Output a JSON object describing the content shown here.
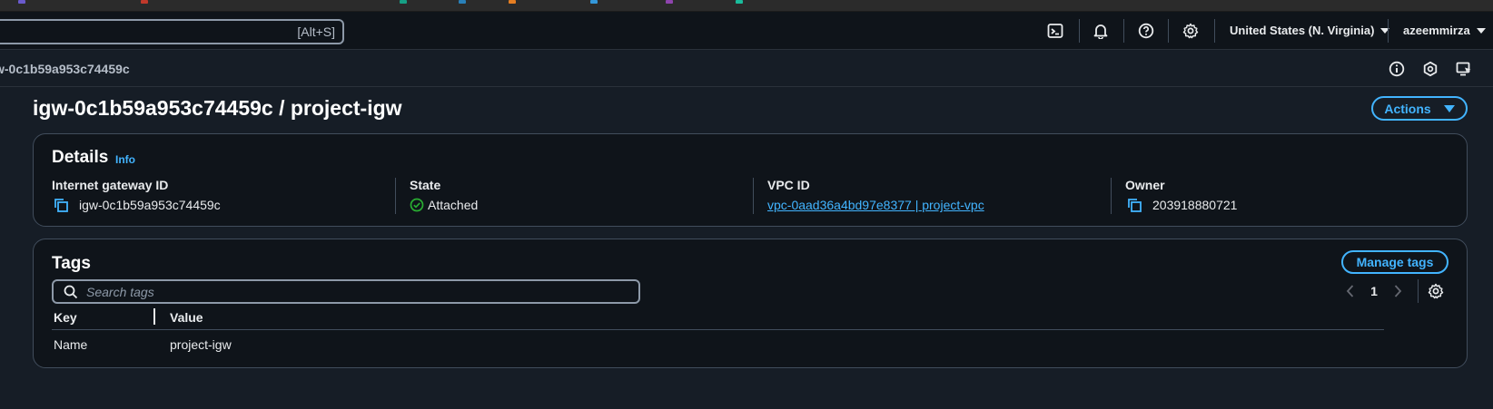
{
  "header": {
    "search_hint": "[Alt+S]",
    "region": "United States (N. Virginia)",
    "user": "azeemmirza",
    "icons": [
      "cloudshell-icon",
      "bell-icon",
      "help-icon",
      "gear-icon"
    ]
  },
  "breadcrumb": {
    "current": "w-0c1b59a953c74459c"
  },
  "page": {
    "title": "igw-0c1b59a953c74459c / project-igw",
    "actions_label": "Actions"
  },
  "details": {
    "title": "Details",
    "info": "Info",
    "igw_label": "Internet gateway ID",
    "igw_value": "igw-0c1b59a953c74459c",
    "state_label": "State",
    "state_value": "Attached",
    "vpc_label": "VPC ID",
    "vpc_value": "vpc-0aad36a4bd97e8377 | project-vpc",
    "owner_label": "Owner",
    "owner_value": "203918880721"
  },
  "tags": {
    "title": "Tags",
    "manage_label": "Manage tags",
    "search_placeholder": "Search tags",
    "page_number": "1",
    "columns": [
      "Key",
      "Value"
    ],
    "rows": [
      {
        "key": "Name",
        "value": "project-igw"
      }
    ]
  },
  "colors": {
    "accent": "#42b4ff",
    "success": "#29ad32",
    "background": "#161d26",
    "panel": "#0f141a"
  }
}
